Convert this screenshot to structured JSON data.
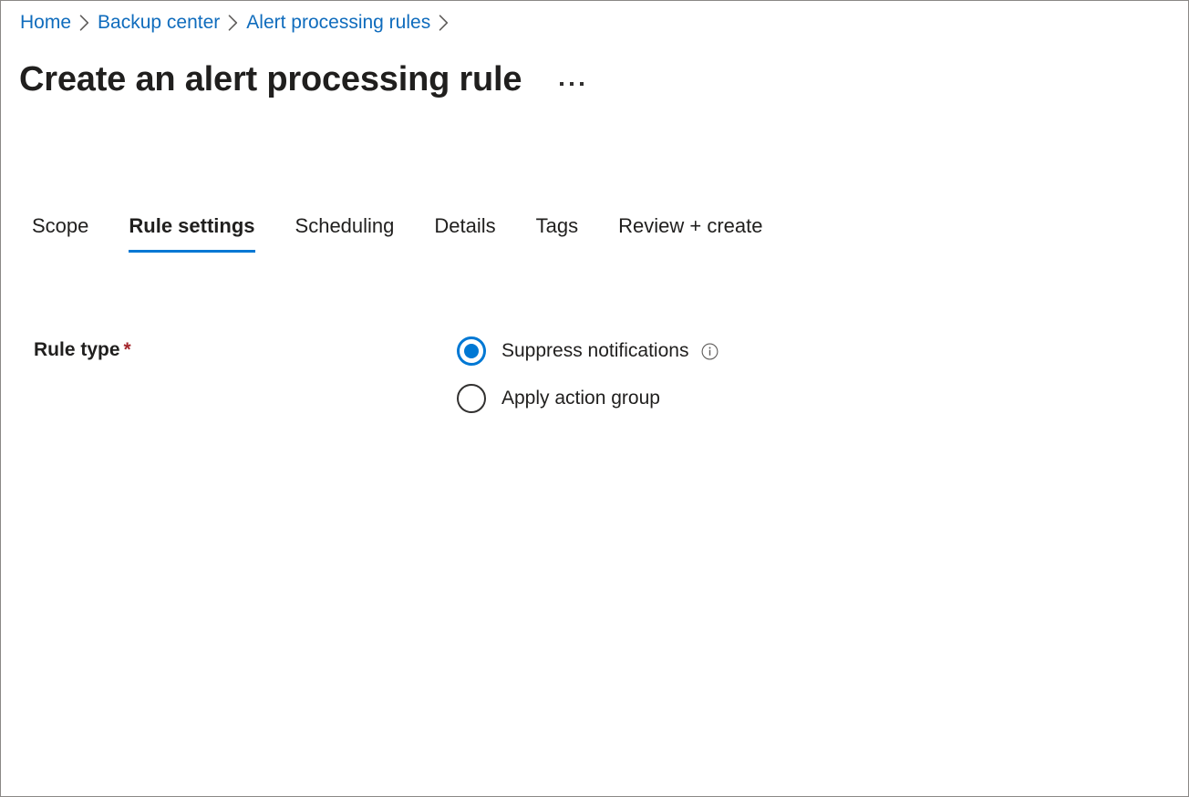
{
  "breadcrumb": {
    "items": [
      {
        "label": "Home"
      },
      {
        "label": "Backup center"
      },
      {
        "label": "Alert processing rules"
      }
    ],
    "separator": "chevron-right-icon",
    "trailing_separator": true
  },
  "header": {
    "title": "Create an alert processing rule",
    "more_menu": "ellipsis-icon"
  },
  "tabs": [
    {
      "label": "Scope",
      "active": false
    },
    {
      "label": "Rule settings",
      "active": true
    },
    {
      "label": "Scheduling",
      "active": false
    },
    {
      "label": "Details",
      "active": false
    },
    {
      "label": "Tags",
      "active": false
    },
    {
      "label": "Review + create",
      "active": false
    }
  ],
  "form": {
    "rule_type": {
      "label": "Rule type",
      "required_marker": "*",
      "options": [
        {
          "label": "Suppress notifications",
          "selected": true,
          "info": "info-icon"
        },
        {
          "label": "Apply action group",
          "selected": false,
          "info": null
        }
      ]
    }
  },
  "colors": {
    "accent": "#0078d4",
    "link": "#0f6cbd",
    "text": "#201f1e",
    "required": "#a4262c",
    "border": "#8a8886",
    "icon_gray": "#605e5c"
  }
}
